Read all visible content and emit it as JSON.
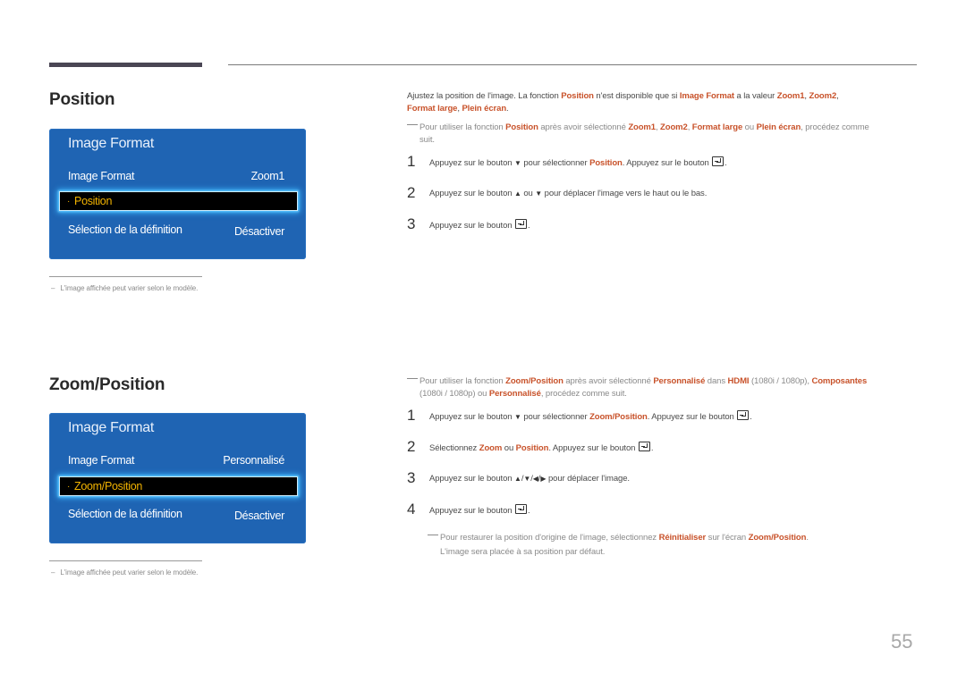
{
  "page_number": "55",
  "sections": [
    {
      "title": "Position",
      "osd": {
        "title": "Image Format",
        "row1_label": "Image Format",
        "row1_value": "Zoom1",
        "selected_bullet": "·",
        "selected_label": "Position",
        "row3_label": "Sélection de la définition",
        "row3_value": "Désactiver"
      },
      "footnote": "L'image affichée peut varier selon le modèle.",
      "intro": {
        "t1": "Ajustez la position de l'image. La fonction ",
        "h1": "Position",
        "t2": " n'est disponible que si ",
        "h2": "Image Format",
        "t3": " a la valeur ",
        "h3": "Zoom1",
        "t4": ", ",
        "h4": "Zoom2",
        "t5": ", ",
        "h5": "Format large",
        "t6": ", ",
        "h6": "Plein écran",
        "t7": "."
      },
      "note": {
        "t1": "Pour utiliser la fonction ",
        "h1": "Position",
        "t2": " après avoir sélectionné ",
        "h2": "Zoom1",
        "t3": ", ",
        "h3": "Zoom2",
        "t4": ", ",
        "h4": "Format large",
        "t5": " ou ",
        "h5": "Plein écran",
        "t6": ", procédez comme",
        "t7": "suit."
      },
      "steps": [
        {
          "num": "1",
          "t1": "Appuyez sur le bouton ",
          "t2": " pour sélectionner ",
          "h1": "Position",
          "t3": ". Appuyez sur le bouton ",
          "t4": "."
        },
        {
          "num": "2",
          "t1": "Appuyez sur le bouton ",
          "t2": " ou ",
          "t3": " pour déplacer l'image vers le haut ou le bas."
        },
        {
          "num": "3",
          "t1": "Appuyez sur le bouton ",
          "t2": "."
        }
      ]
    },
    {
      "title": "Zoom/Position",
      "osd": {
        "title": "Image Format",
        "row1_label": "Image Format",
        "row1_value": "Personnalisé",
        "selected_bullet": "·",
        "selected_label": "Zoom/Position",
        "row3_label": "Sélection de la définition",
        "row3_value": "Désactiver"
      },
      "footnote": "L'image affichée peut varier selon le modèle.",
      "note": {
        "t1": "Pour utiliser la fonction ",
        "h1": "Zoom/Position",
        "t2": " après avoir sélectionné ",
        "h2": "Personnalisé",
        "t3": " dans ",
        "h3": "HDMI",
        "t4": " (1080i / 1080p), ",
        "h4": "Composantes",
        "t5": "(1080i / 1080p) ou ",
        "h5": "Personnalisé",
        "t6": ", procédez comme suit."
      },
      "steps": [
        {
          "num": "1",
          "t1": "Appuyez sur le bouton ",
          "t2": " pour sélectionner ",
          "h1": "Zoom/Position",
          "t3": ". Appuyez sur le bouton ",
          "t4": "."
        },
        {
          "num": "2",
          "t1": "Sélectionnez ",
          "h1": "Zoom",
          "t2": " ou ",
          "h2": "Position",
          "t3": ". Appuyez sur le bouton ",
          "t4": "."
        },
        {
          "num": "3",
          "t1": "Appuyez sur le bouton ",
          "t2": " pour déplacer l'image."
        },
        {
          "num": "4",
          "t1": "Appuyez sur le bouton ",
          "t2": "."
        }
      ],
      "note2": {
        "t1": "Pour restaurer la position d'origine de l'image, sélectionnez ",
        "h1": "Réinitialiser",
        "t2": " sur l'écran ",
        "h2": "Zoom/Position",
        "t3": ".",
        "t4": "L'image sera placée à sa position par défaut."
      }
    }
  ],
  "icons": {
    "down": "▼",
    "up": "▲",
    "left": "◀",
    "right": "▶",
    "slash": "/"
  }
}
